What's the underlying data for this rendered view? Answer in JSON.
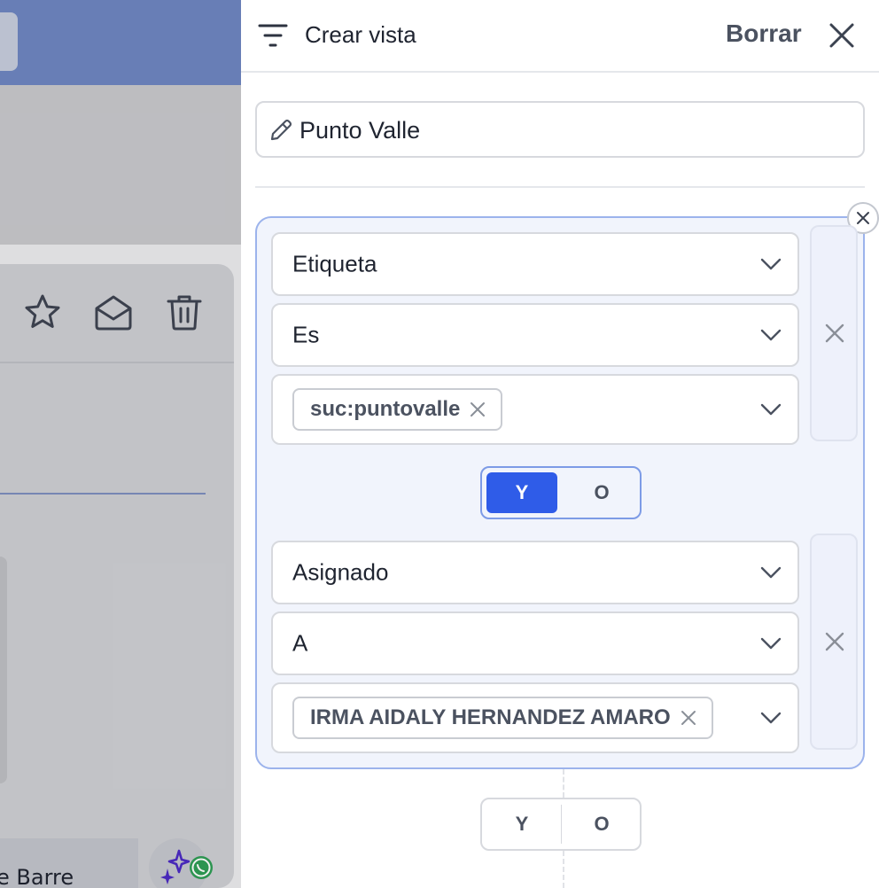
{
  "drawer": {
    "title": "Crear vista",
    "clear_label": "Borrar",
    "view_name": "Punto Valle"
  },
  "group": {
    "conditions": [
      {
        "field": "Etiqueta",
        "operator": "Es",
        "value_chip": "suc:puntovalle"
      },
      {
        "field": "Asignado",
        "operator": "A",
        "value_chip": "IRMA AIDALY HERNANDEZ AMARO"
      }
    ],
    "inner_connector": {
      "y_label": "Y",
      "o_label": "O",
      "selected": "Y"
    }
  },
  "outer_connector": {
    "y_label": "Y",
    "o_label": "O",
    "selected": ""
  },
  "background": {
    "partial_text": "e Barre"
  },
  "colors": {
    "accent": "#2f5ce8",
    "group_border": "#9cb3ec",
    "group_bg": "#f1f4fc"
  },
  "icons": {
    "header_left": "filter-lines-icon",
    "close": "close-icon",
    "pencil": "pencil-icon",
    "chevron": "chevron-down-icon",
    "bg_toolbar": [
      "star-icon",
      "envelope-open-icon",
      "trash-icon"
    ],
    "bg_fab": [
      "sparkle-icon",
      "whatsapp-icon"
    ]
  }
}
